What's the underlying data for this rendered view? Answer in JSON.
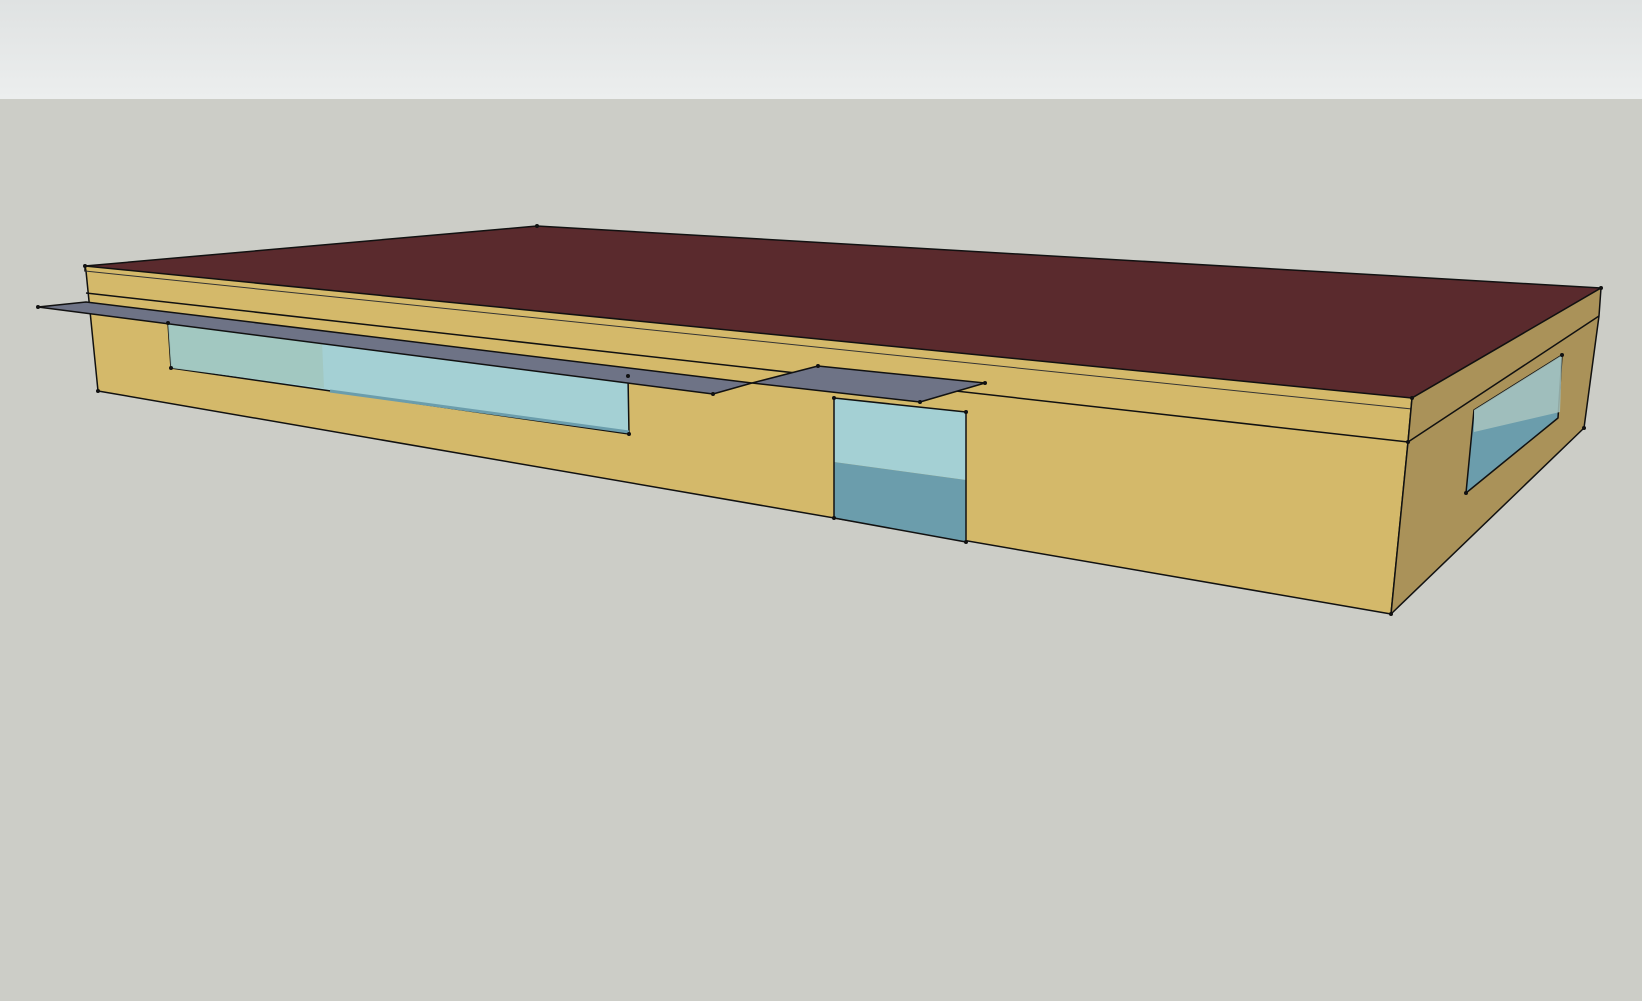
{
  "app": {
    "title": ""
  },
  "scene": {
    "sky_colors": [
      "#dcdfdf",
      "#eceeee"
    ],
    "ground_color": "#cccdc7",
    "roof_color": "#5a2a2d",
    "wall_front_color": "#d4b96a",
    "wall_side_color": "#aa9259",
    "glass_upper_color": "#a4d0d4",
    "glass_lower_color": "#6b9dac",
    "awning_color": "#6e7386",
    "edge_color": "#111111"
  }
}
